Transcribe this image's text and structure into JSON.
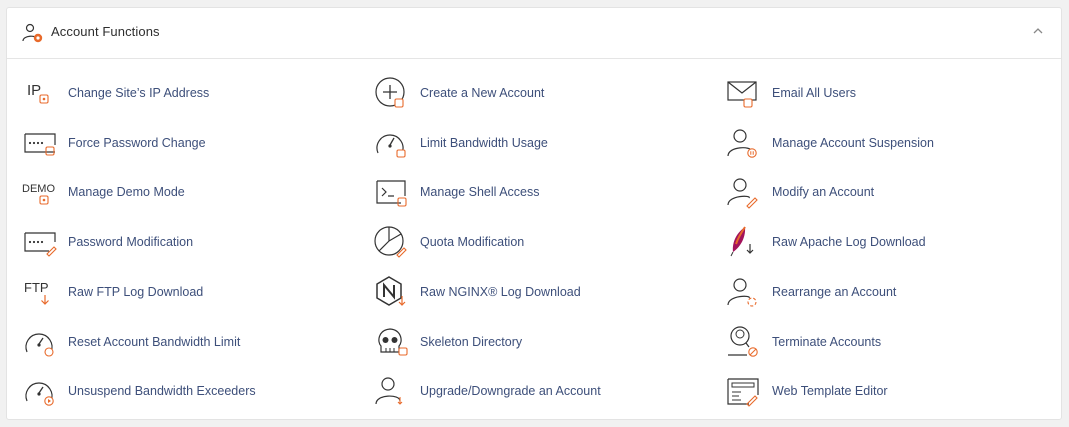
{
  "section": {
    "title": "Account Functions"
  },
  "colors": {
    "accent": "#e86a2b",
    "link": "#3d4f7a",
    "icon": "#333333"
  },
  "columns": [
    [
      {
        "label": "Change Site’s IP Address",
        "icon": "ip-icon"
      },
      {
        "label": "Force Password Change",
        "icon": "password-field-icon"
      },
      {
        "label": "Manage Demo Mode",
        "icon": "demo-icon"
      },
      {
        "label": "Password Modification",
        "icon": "password-edit-icon"
      },
      {
        "label": "Raw FTP Log Download",
        "icon": "ftp-download-icon"
      },
      {
        "label": "Reset Account Bandwidth Limit",
        "icon": "gauge-reset-icon"
      },
      {
        "label": "Unsuspend Bandwidth Exceeders",
        "icon": "gauge-play-icon"
      }
    ],
    [
      {
        "label": "Create a New Account",
        "icon": "plus-circle-icon"
      },
      {
        "label": "Limit Bandwidth Usage",
        "icon": "gauge-limit-icon"
      },
      {
        "label": "Manage Shell Access",
        "icon": "terminal-icon"
      },
      {
        "label": "Quota Modification",
        "icon": "pie-chart-icon"
      },
      {
        "label": "Raw NGINX® Log Download",
        "icon": "nginx-download-icon"
      },
      {
        "label": "Skeleton Directory",
        "icon": "skull-icon"
      },
      {
        "label": "Upgrade/Downgrade an Account",
        "icon": "user-swap-icon"
      }
    ],
    [
      {
        "label": "Email All Users",
        "icon": "envelope-icon"
      },
      {
        "label": "Manage Account Suspension",
        "icon": "user-pause-icon"
      },
      {
        "label": "Modify an Account",
        "icon": "user-edit-icon"
      },
      {
        "label": "Raw Apache Log Download",
        "icon": "apache-feather-icon"
      },
      {
        "label": "Rearrange an Account",
        "icon": "user-move-icon"
      },
      {
        "label": "Terminate Accounts",
        "icon": "user-search-block-icon"
      },
      {
        "label": "Web Template Editor",
        "icon": "template-editor-icon"
      }
    ]
  ]
}
